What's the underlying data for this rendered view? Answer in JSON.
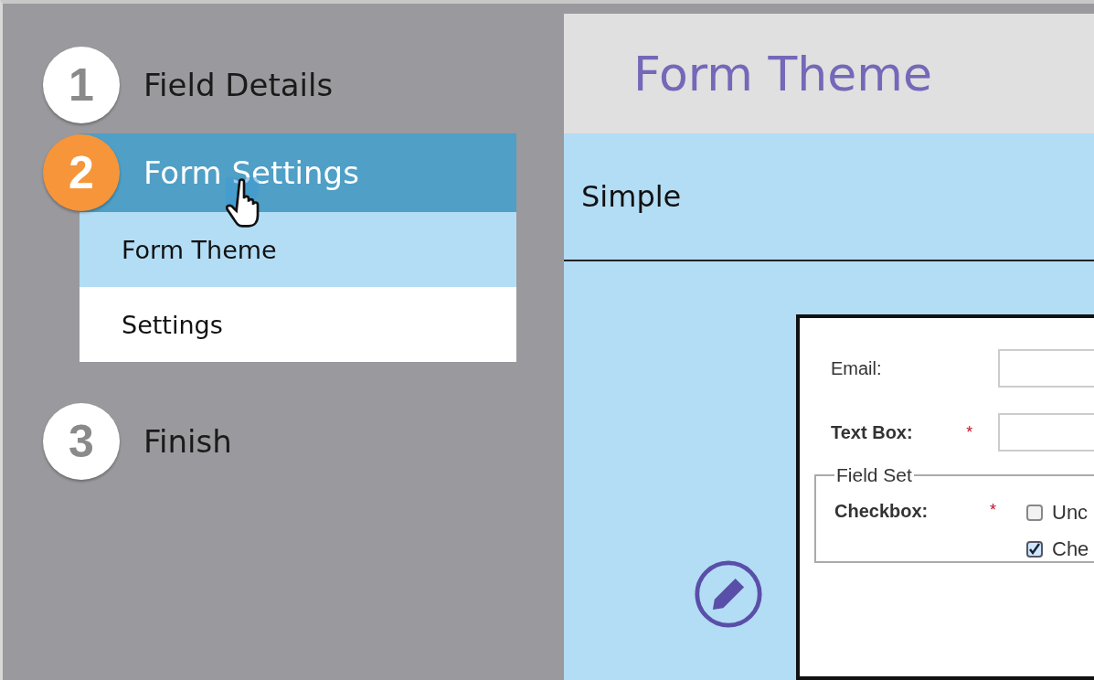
{
  "steps": [
    {
      "number": "1",
      "label": "Field Details",
      "selected": false
    },
    {
      "number": "2",
      "label": "Form Settings",
      "selected": true,
      "children": [
        {
          "label": "Form Theme",
          "selected": true
        },
        {
          "label": "Settings",
          "selected": false
        }
      ]
    },
    {
      "number": "3",
      "label": "Finish",
      "selected": false
    }
  ],
  "main": {
    "title": "Form Theme",
    "theme_name": "Simple",
    "preview": {
      "fields": [
        {
          "kind": "text",
          "label": "Email:",
          "required": false
        },
        {
          "kind": "text",
          "label": "Text Box:",
          "required": true,
          "required_mark": "*"
        }
      ],
      "fieldset": {
        "legend": "Field Set",
        "fields": [
          {
            "kind": "checkbox",
            "label": "Checkbox:",
            "required": true,
            "required_mark": "*",
            "options": [
              {
                "label": "Unc",
                "checked": false
              },
              {
                "label": "Che",
                "checked": true
              }
            ]
          }
        ]
      }
    }
  }
}
